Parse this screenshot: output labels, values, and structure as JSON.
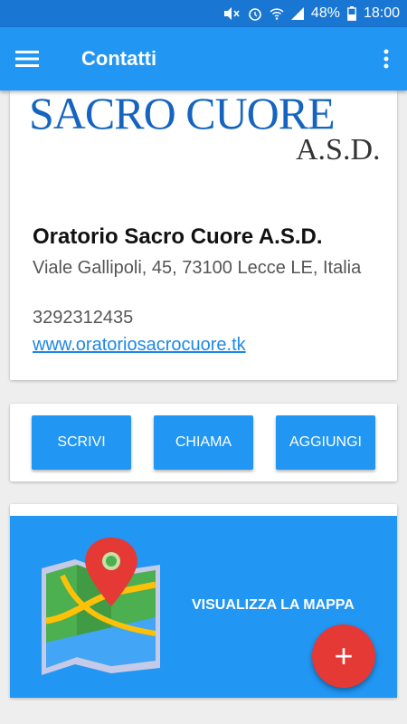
{
  "status_bar": {
    "battery": "48%",
    "time": "18:00"
  },
  "app_bar": {
    "title": "Contatti"
  },
  "info": {
    "logo_text": "SACRO CUORE",
    "logo_subtext": "A.S.D.",
    "name": "Oratorio Sacro Cuore A.S.D.",
    "address": "Viale Gallipoli, 45, 73100 Lecce LE, Italia",
    "phone": "3292312435",
    "website": "www.oratoriosacrocuore.tk"
  },
  "actions": {
    "write": "SCRIVI",
    "call": "CHIAMA",
    "add": "AGGIUNGI"
  },
  "map": {
    "label": "VISUALIZZA LA MAPPA"
  },
  "fab": {
    "symbol": "+"
  },
  "colors": {
    "primary": "#2196F3",
    "primary_dark": "#1976D2",
    "accent": "#E53935"
  }
}
